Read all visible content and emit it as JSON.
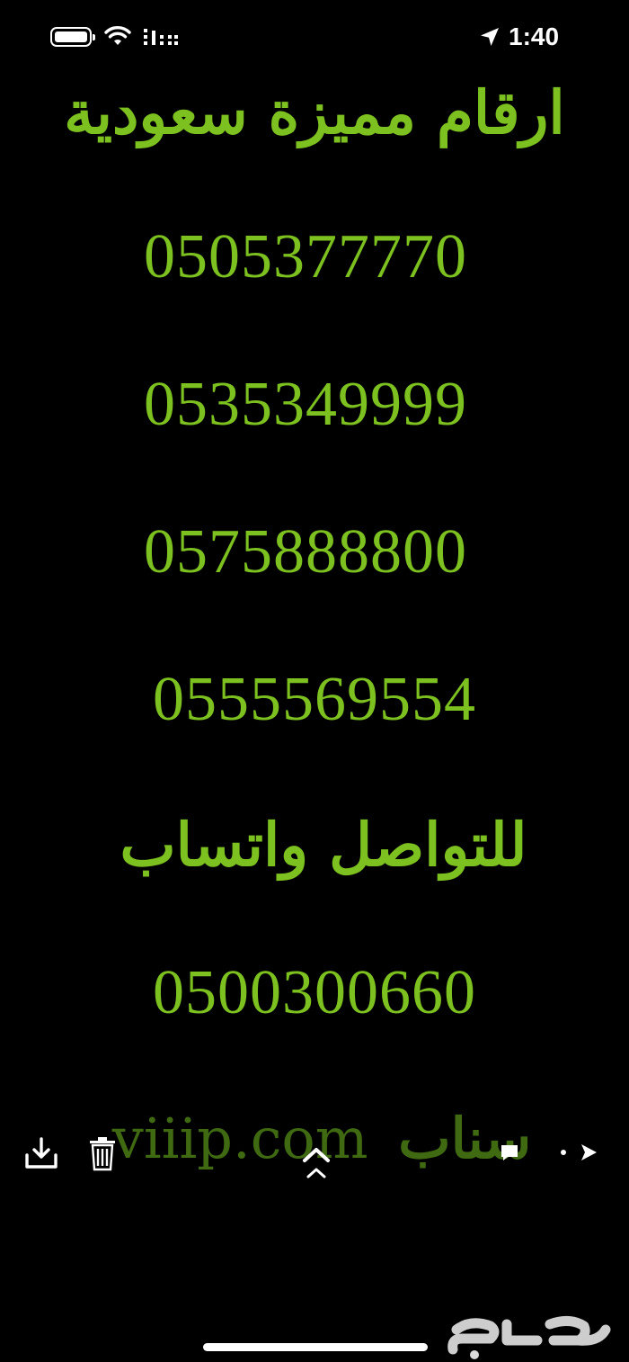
{
  "status_bar": {
    "time": "1:40",
    "battery_icon": "battery-icon",
    "wifi_icon": "wifi-icon",
    "signal_icon": "cellular-signal-icon",
    "location_icon": "location-arrow-icon"
  },
  "image": {
    "title": "ارقام مميزة سعودية",
    "numbers": [
      "0505377770",
      "0535349999",
      "0575888800",
      "0555569554"
    ],
    "contact_label": "للتواصل واتساب",
    "contact_number": "0500300660",
    "snap_label": "سناب",
    "snap_handle": "viiip.com",
    "text_color": "#7cc11f"
  },
  "toolbar": {
    "icons": [
      "download-icon",
      "trash-icon",
      "chevron-up-icon",
      "comment-icon",
      "dot-icon",
      "play-icon"
    ]
  },
  "watermark": {
    "logo_text": "حراج"
  }
}
